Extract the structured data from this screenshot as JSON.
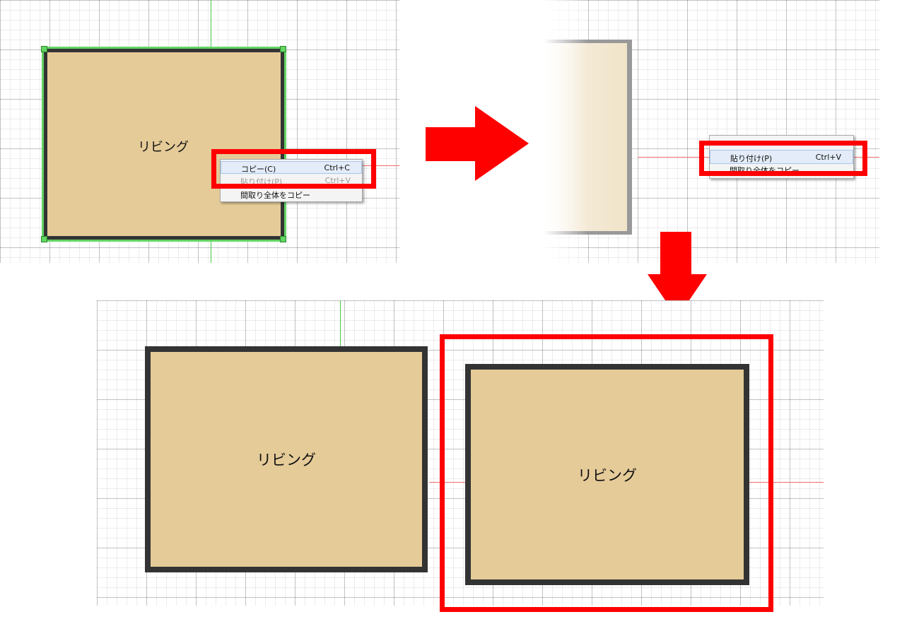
{
  "step1": {
    "room_label": "リビング",
    "context_menu": {
      "items": [
        {
          "label": "コピー(C)",
          "shortcut": "Ctrl+C"
        },
        {
          "label": "貼り付け(P)",
          "shortcut": "Ctrl+V",
          "disabled": true
        },
        {
          "label": "間取り全体をコピー",
          "shortcut": ""
        }
      ]
    }
  },
  "step2": {
    "context_menu": {
      "items": [
        {
          "label": "貼り付け(P)",
          "shortcut": "Ctrl+V"
        },
        {
          "label": "間取り全体をコピー",
          "shortcut": ""
        }
      ]
    }
  },
  "step3": {
    "original_room_label": "リビング",
    "pasted_room_label": "リビング"
  },
  "colors": {
    "room_fill": "#e5cb98",
    "room_wall": "#333333",
    "highlight": "#ff0000",
    "selection": "#63d463",
    "grid_axis_y": "#44c944",
    "grid_axis_x": "#ee6b6b"
  }
}
